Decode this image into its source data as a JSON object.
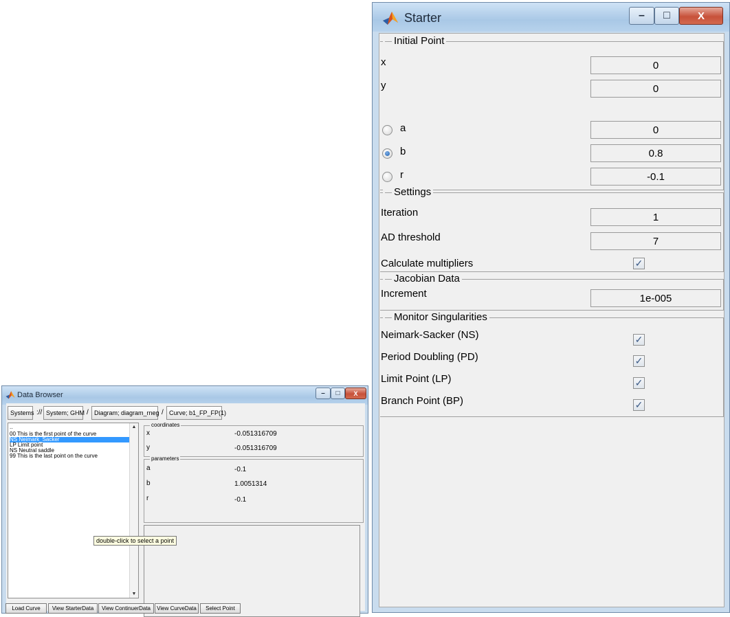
{
  "starter": {
    "title": "Starter",
    "initial_point": {
      "heading": "Initial Point",
      "x_label": "x",
      "x_value": "0",
      "y_label": "y",
      "y_value": "0",
      "a_label": "a",
      "a_value": "0",
      "b_label": "b",
      "b_value": "0.8",
      "r_label": "r",
      "r_value": "-0.1",
      "selected_parameter": "b"
    },
    "settings": {
      "heading": "Settings",
      "iteration_label": "Iteration",
      "iteration_value": "1",
      "ad_label": "AD threshold",
      "ad_value": "7",
      "multipliers_label": "Calculate multipliers",
      "multipliers_checked": true
    },
    "jacobian": {
      "heading": "Jacobian Data",
      "increment_label": "Increment",
      "increment_value": "1e-005"
    },
    "monitor": {
      "heading": "Monitor Singularities",
      "ns_label": "Neimark-Sacker (NS)",
      "pd_label": "Period Doubling (PD)",
      "lp_label": "Limit Point (LP)",
      "bp_label": "Branch Point (BP)"
    },
    "checkmark": "✓"
  },
  "browser": {
    "title": "Data Browser",
    "crumbs": {
      "systems": "Systems",
      "root": "://",
      "system": "System; GHM",
      "sep1": "/",
      "diagram": "Diagram; diagram_rneg",
      "sep2": "/",
      "curve": "Curve; b1_FP_FP(1)"
    },
    "points": [
      "..",
      "00  This is the first point of the curve",
      "NS  Neimark_Sacker",
      "LP  Limit point",
      "NS  Neutral saddle",
      "99  This is the last point on the curve"
    ],
    "coordinates": {
      "heading": "coordinates",
      "x_label": "x",
      "x_value": "-0.051316709",
      "y_label": "y",
      "y_value": "-0.051316709"
    },
    "parameters": {
      "heading": "parameters",
      "a_label": "a",
      "a_value": "-0.1",
      "b_label": "b",
      "b_value": "1.0051314",
      "r_label": "r",
      "r_value": "-0.1"
    },
    "tooltip": "double-click to select a point",
    "buttons": {
      "load_curve": "Load Curve",
      "view_starter": "View StarterData",
      "view_continuer": "View ContinuerData",
      "view_curve": "View CurveData",
      "select_point": "Select Point"
    },
    "scroll_up": "▲",
    "scroll_down": "▼"
  },
  "window_controls": {
    "minimize": "–",
    "maximize": "□",
    "close": "X"
  }
}
